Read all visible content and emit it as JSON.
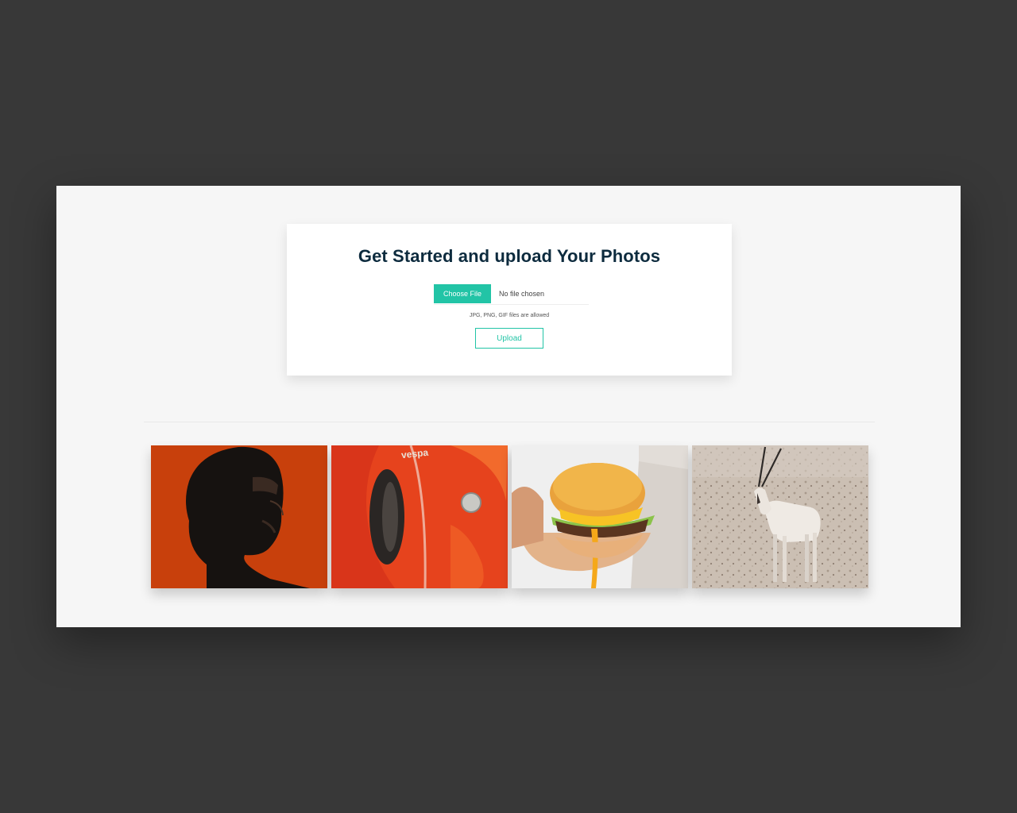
{
  "upload_card": {
    "title": "Get Started and upload Your Photos",
    "choose_file_label": "Choose File",
    "file_status": "No file chosen",
    "hint": "JPG, PNG, GIF files are allowed",
    "upload_label": "Upload"
  },
  "gallery": {
    "photos": [
      {
        "subject": "portrait"
      },
      {
        "subject": "scooter",
        "text": "vespa"
      },
      {
        "subject": "burger"
      },
      {
        "subject": "oryx"
      }
    ]
  },
  "colors": {
    "background": "#383838",
    "page": "#f6f6f6",
    "accent": "#22c4a6",
    "title": "#0d2b3e"
  }
}
